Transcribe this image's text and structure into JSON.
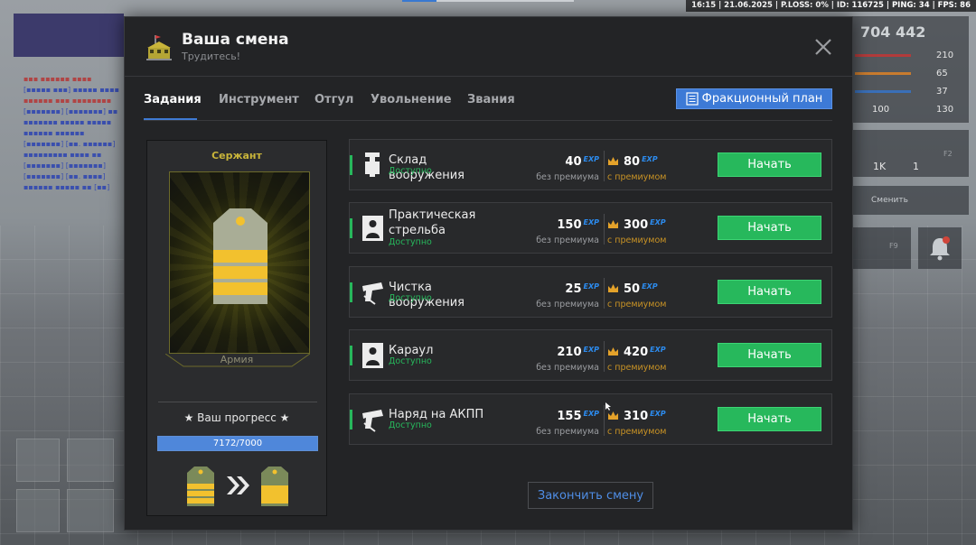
{
  "overlay": {
    "stats": "16:15 | 21.06.2025 | P.LOSS: 0% | ID: 116725 | PING: 34 | FPS: 86",
    "money": "704 442",
    "hud_values": [
      "210",
      "65",
      "37",
      "100",
      "130"
    ],
    "hud_items": [
      "1K",
      "1",
      "F2"
    ],
    "change_label": "Сменить",
    "f9": "F9"
  },
  "modal": {
    "title": "Ваша смена",
    "subtitle": "Трудитесь!"
  },
  "tabs": [
    {
      "label": "Задания",
      "active": true
    },
    {
      "label": "Инструмент",
      "active": false
    },
    {
      "label": "Отгул",
      "active": false
    },
    {
      "label": "Увольнение",
      "active": false
    },
    {
      "label": "Звания",
      "active": false
    }
  ],
  "plan_button": {
    "label": "Фракционный план",
    "icon": "document-icon"
  },
  "rank": {
    "name": "Сержант",
    "faction": "Армия",
    "progress_title": "★ Ваш прогресс ★",
    "progress_text": "7172/7000",
    "progress_fraction": 1.0
  },
  "tasks": [
    {
      "name": "Склад вооружения",
      "status": "Доступно",
      "base": "40",
      "premium": "80",
      "icon": "weapon-storage-icon"
    },
    {
      "name": "Практическая стрельба",
      "status": "Доступно",
      "base": "150",
      "premium": "300",
      "icon": "shooting-target-icon"
    },
    {
      "name": "Чистка вооружения",
      "status": "Доступно",
      "base": "25",
      "premium": "50",
      "icon": "pistol-cleaning-icon"
    },
    {
      "name": "Караул",
      "status": "Доступно",
      "base": "210",
      "premium": "420",
      "icon": "guard-icon"
    },
    {
      "name": "Наряд на АКПП",
      "status": "Доступно",
      "base": "155",
      "premium": "310",
      "icon": "checkpoint-icon"
    }
  ],
  "labels": {
    "exp": "EXP",
    "no_premium": "без премиума",
    "with_premium": "с премиумом",
    "start": "Начать"
  },
  "finish_button": "Закончить смену",
  "colors": {
    "accent_blue": "#3d7ad6",
    "start_green": "#27b85c",
    "premium_gold": "#c99325",
    "rank_yellow": "#f2c12e"
  }
}
